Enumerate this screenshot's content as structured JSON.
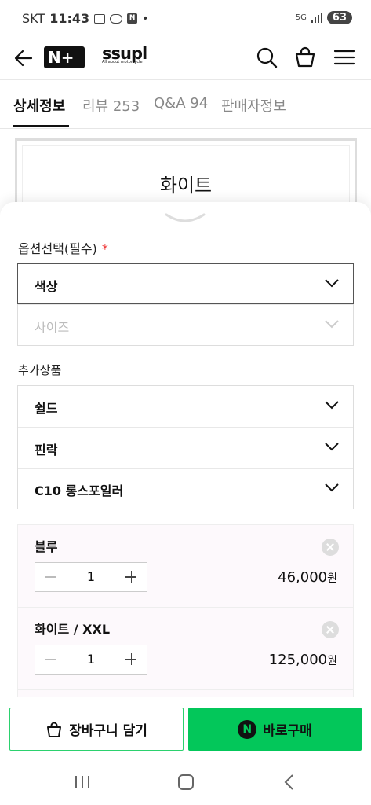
{
  "status_bar": {
    "carrier": "SKT",
    "time": "11:43",
    "notif_n": "N",
    "dot": "•",
    "network": "5G",
    "battery": "63"
  },
  "header": {
    "logo_brand": "N+",
    "logo_store": "ssupl",
    "logo_store_sub": "All about motorcycle"
  },
  "tabs": [
    {
      "label": "상세정보",
      "active": true
    },
    {
      "label": "리뷰 253",
      "active": false
    },
    {
      "label": "Q&A 94",
      "active": false
    },
    {
      "label": "판매자정보",
      "active": false
    }
  ],
  "product_preview_title": "화이트",
  "options": {
    "required_label": "옵션선택(필수)",
    "required_marker": "*",
    "selects": [
      {
        "label": "색상",
        "state": "active"
      },
      {
        "label": "사이즈",
        "state": "disabled"
      }
    ],
    "addon_label": "추가상품",
    "addons": [
      {
        "label": "쉴드"
      },
      {
        "label": "핀락"
      },
      {
        "label": "C10 롱스포일러"
      }
    ]
  },
  "selected_items": [
    {
      "name": "블루",
      "quantity": "1",
      "price": "46,000",
      "currency": "원"
    },
    {
      "name": "화이트 / XXL",
      "quantity": "1",
      "price": "125,000",
      "currency": "원"
    }
  ],
  "actions": {
    "cart_label": "장바구니 담기",
    "buy_label": "바로구매",
    "buy_badge": "N"
  },
  "colors": {
    "accent_green": "#03c75a",
    "required_red": "#e33333"
  }
}
